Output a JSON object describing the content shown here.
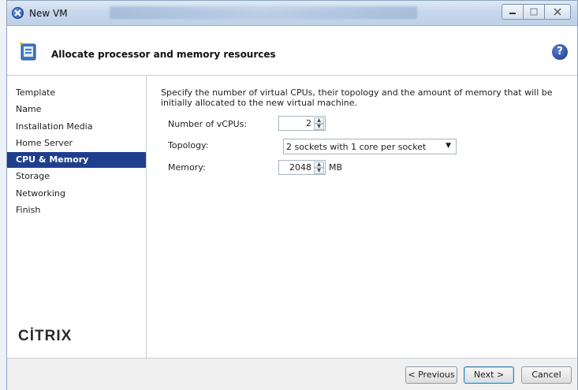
{
  "window": {
    "title": "New VM",
    "controls": {
      "minimize": "minimize-icon",
      "maximize": "maximize-icon",
      "close": "close-icon"
    }
  },
  "header": {
    "title": "Allocate processor and memory resources",
    "icon": "wizard-step-icon",
    "help_icon": "help-icon",
    "help_glyph": "?"
  },
  "sidebar": {
    "items": [
      {
        "label": "Template"
      },
      {
        "label": "Name"
      },
      {
        "label": "Installation Media"
      },
      {
        "label": "Home Server"
      },
      {
        "label": "CPU & Memory",
        "selected": true
      },
      {
        "label": "Storage"
      },
      {
        "label": "Networking"
      },
      {
        "label": "Finish"
      }
    ],
    "logo": "CİTRIX"
  },
  "main": {
    "description": "Specify the number of virtual CPUs, their topology and the amount of memory that will be initially allocated to the new virtual machine.",
    "vcpus": {
      "label": "Number of vCPUs:",
      "value": "2"
    },
    "topology": {
      "label": "Topology:",
      "value": "2 sockets with 1 core per socket"
    },
    "memory": {
      "label": "Memory:",
      "value": "2048",
      "unit": "MB"
    }
  },
  "footer": {
    "previous": "< Previous",
    "next": "Next >",
    "cancel": "Cancel"
  },
  "colors": {
    "selected_bg": "#1f3f8c",
    "titlebar": "#c7d8ec"
  }
}
